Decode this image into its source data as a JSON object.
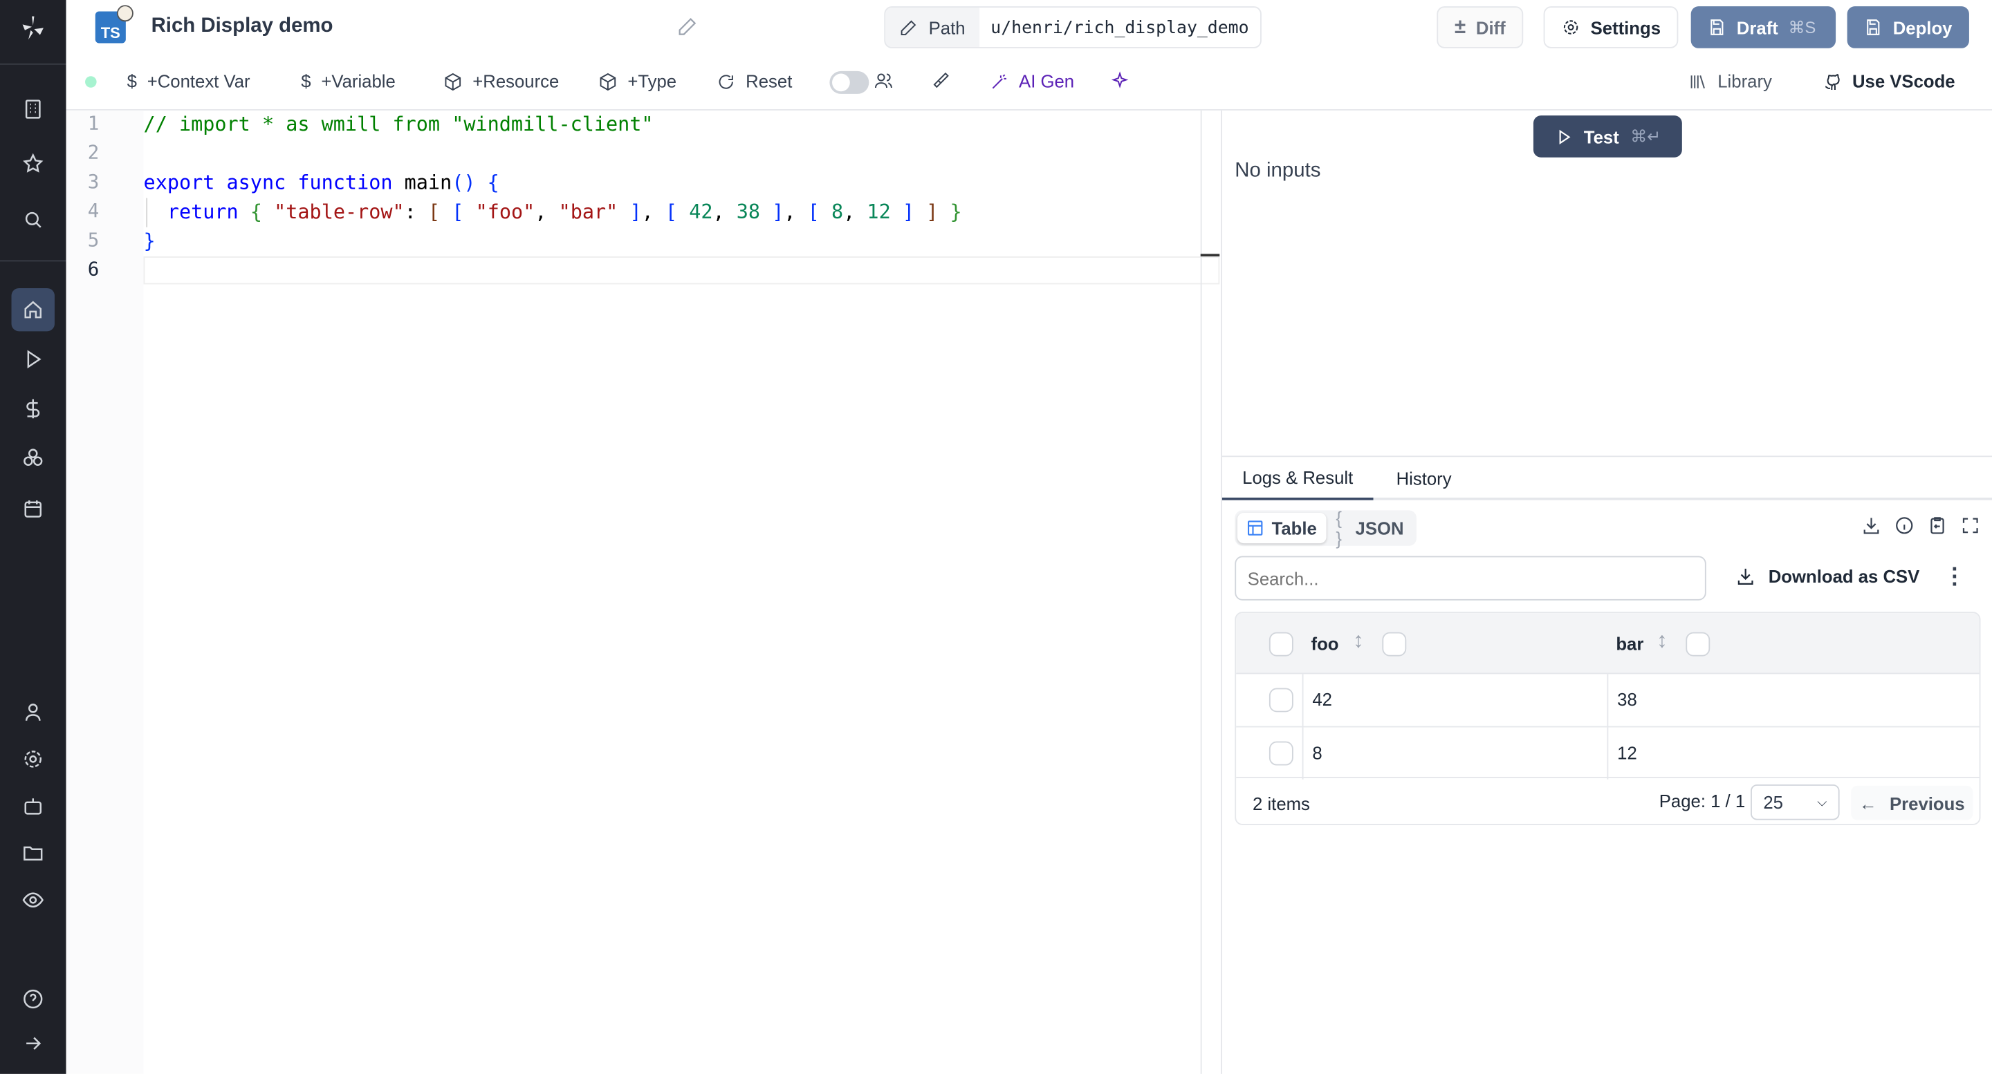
{
  "header": {
    "title": "Rich Display demo",
    "lang_badge": "TS",
    "path_label": "Path",
    "path_value": "u/henri/rich_display_demo",
    "diff": "Diff",
    "settings": "Settings",
    "draft": "Draft",
    "draft_shortcut": "⌘S",
    "deploy": "Deploy"
  },
  "toolbar": {
    "context_var": "+Context Var",
    "variable": "+Variable",
    "resource": "+Resource",
    "type": "+Type",
    "reset": "Reset",
    "ai_gen": "AI Gen",
    "library": "Library",
    "use_vscode": "Use VScode",
    "status_color": "#a7f3d0",
    "ai_color": "#5b21b6"
  },
  "editor": {
    "line_numbers": [
      "1",
      "2",
      "3",
      "4",
      "5",
      "6"
    ],
    "current_line": 6,
    "lines": [
      [
        {
          "t": "// import * as wmill from \"windmill-client\"",
          "c": "c"
        }
      ],
      [],
      [
        {
          "t": "export async function ",
          "c": "k"
        },
        {
          "t": "main",
          "c": "p"
        },
        {
          "t": "() {",
          "c": "b1"
        }
      ],
      [
        {
          "t": "  return ",
          "c": "k"
        },
        {
          "t": "{ ",
          "c": "b2"
        },
        {
          "t": "\"table-row\"",
          "c": "s"
        },
        {
          "t": ": ",
          "c": "p"
        },
        {
          "t": "[ ",
          "c": "b3"
        },
        {
          "t": "[ ",
          "c": "b1"
        },
        {
          "t": "\"foo\"",
          "c": "s"
        },
        {
          "t": ", ",
          "c": "p"
        },
        {
          "t": "\"bar\"",
          "c": "s"
        },
        {
          "t": " ]",
          "c": "b1"
        },
        {
          "t": ", ",
          "c": "p"
        },
        {
          "t": "[ ",
          "c": "b1"
        },
        {
          "t": "42",
          "c": "n"
        },
        {
          "t": ", ",
          "c": "p"
        },
        {
          "t": "38",
          "c": "n"
        },
        {
          "t": " ]",
          "c": "b1"
        },
        {
          "t": ", ",
          "c": "p"
        },
        {
          "t": "[ ",
          "c": "b1"
        },
        {
          "t": "8",
          "c": "n"
        },
        {
          "t": ", ",
          "c": "p"
        },
        {
          "t": "12",
          "c": "n"
        },
        {
          "t": " ]",
          "c": "b1"
        },
        {
          "t": " ]",
          "c": "b3"
        },
        {
          "t": " }",
          "c": "b2"
        }
      ],
      [
        {
          "t": "}",
          "c": "b1"
        }
      ],
      []
    ]
  },
  "test": {
    "label": "Test",
    "shortcut": "⌘↵",
    "no_inputs": "No inputs"
  },
  "result": {
    "tabs": [
      "Logs & Result",
      "History"
    ],
    "view_table": "Table",
    "view_json": "JSON",
    "search_placeholder": "Search...",
    "download_csv": "Download as CSV",
    "columns": [
      "foo",
      "bar"
    ],
    "rows": [
      [
        "42",
        "38"
      ],
      [
        "8",
        "12"
      ]
    ],
    "items": "2 items",
    "page": "Page: 1 / 1",
    "page_size": "25",
    "previous": "Previous"
  }
}
